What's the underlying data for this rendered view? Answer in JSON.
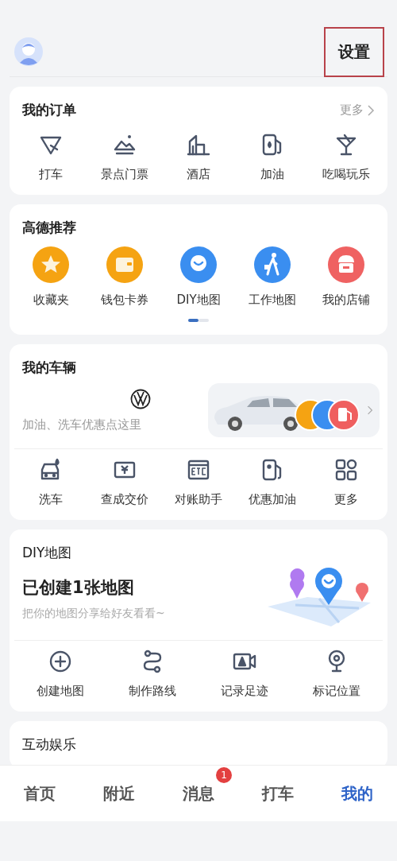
{
  "header": {
    "settings": "设置"
  },
  "orders": {
    "title": "我的订单",
    "more": "更多",
    "items": [
      "打车",
      "景点门票",
      "酒店",
      "加油",
      "吃喝玩乐"
    ]
  },
  "recommend": {
    "title": "高德推荐",
    "items": [
      {
        "label": "收藏夹",
        "color": "#f5a312"
      },
      {
        "label": "钱包卡券",
        "color": "#f5a312"
      },
      {
        "label": "DIY地图",
        "color": "#3a8ef0"
      },
      {
        "label": "工作地图",
        "color": "#3a8ef0"
      },
      {
        "label": "我的店铺",
        "color": "#ef6262"
      }
    ],
    "pager": [
      {
        "selected": true
      },
      {
        "selected": false
      }
    ]
  },
  "vehicle": {
    "title": "我的车辆",
    "hint": "加油、洗车优惠点这里",
    "services": [
      "洗车",
      "查成交价",
      "对账助手",
      "优惠加油",
      "更多"
    ]
  },
  "diy": {
    "title": "DIY地图",
    "headline": "已创建1张地图",
    "subtitle": "把你的地图分享给好友看看~",
    "actions": [
      "创建地图",
      "制作路线",
      "记录足迹",
      "标记位置"
    ]
  },
  "entertainment": {
    "title": "互动娱乐"
  },
  "tabs": [
    {
      "label": "首页",
      "selected": false
    },
    {
      "label": "附近",
      "selected": false
    },
    {
      "label": "消息",
      "selected": false,
      "badge": "1"
    },
    {
      "label": "打车",
      "selected": false
    },
    {
      "label": "我的",
      "selected": true
    }
  ]
}
